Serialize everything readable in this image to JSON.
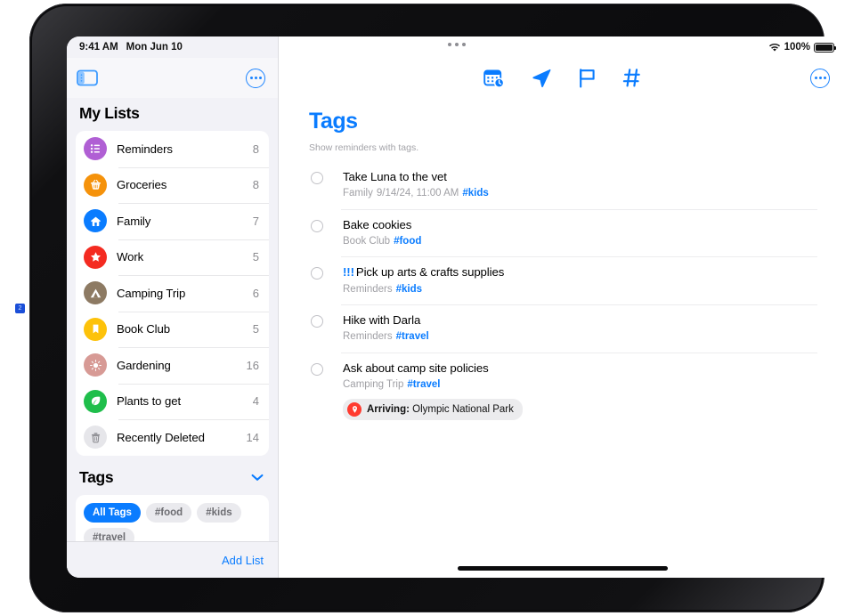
{
  "status_bar": {
    "time": "9:41 AM",
    "date": "Mon Jun 10",
    "wifi_icon": "wifi-icon",
    "battery_percent": "100%",
    "battery_icon": "battery-full-icon"
  },
  "window_controls": {
    "dots_icon": "window-drag-dots-icon"
  },
  "sidebar": {
    "toggle_icon": "sidebar-toggle-icon",
    "more_icon": "more-options-icon",
    "my_lists_title": "My Lists",
    "lists": [
      {
        "label": "Reminders",
        "count": "8",
        "icon": "list-bullet-icon",
        "color": "#b05fd4"
      },
      {
        "label": "Groceries",
        "count": "8",
        "icon": "basket-icon",
        "color": "#f5920b"
      },
      {
        "label": "Family",
        "count": "7",
        "icon": "house-icon",
        "color": "#0a7cff"
      },
      {
        "label": "Work",
        "count": "5",
        "icon": "star-icon",
        "color": "#f42b21"
      },
      {
        "label": "Camping Trip",
        "count": "6",
        "icon": "tent-icon",
        "color": "#8d7a63"
      },
      {
        "label": "Book Club",
        "count": "5",
        "icon": "bookmark-icon",
        "color": "#fdc20a"
      },
      {
        "label": "Gardening",
        "count": "16",
        "icon": "sun-icon",
        "color": "#d79a95"
      },
      {
        "label": "Plants to get",
        "count": "4",
        "icon": "leaf-icon",
        "color": "#1fbe4b"
      },
      {
        "label": "Recently Deleted",
        "count": "14",
        "icon": "trash-icon",
        "color": "#e8e8ea"
      }
    ],
    "tags_title": "Tags",
    "tags_chevron_icon": "chevron-down-icon",
    "tag_chips": [
      {
        "label": "All Tags",
        "selected": true
      },
      {
        "label": "#food",
        "selected": false
      },
      {
        "label": "#kids",
        "selected": false
      },
      {
        "label": "#travel",
        "selected": false
      }
    ],
    "add_list_label": "Add List"
  },
  "main": {
    "toolbar_icons": [
      {
        "name": "scheduled-calendar-icon"
      },
      {
        "name": "location-arrow-icon"
      },
      {
        "name": "flag-icon"
      },
      {
        "name": "hashtag-icon"
      }
    ],
    "more_icon": "more-options-icon",
    "title": "Tags",
    "subtitle": "Show reminders with tags.",
    "reminders": [
      {
        "priority": "",
        "title": "Take Luna to the vet",
        "list": "Family",
        "when": "9/14/24, 11:00 AM",
        "tag": "#kids",
        "location_badge": null
      },
      {
        "priority": "",
        "title": "Bake cookies",
        "list": "Book Club",
        "when": "",
        "tag": "#food",
        "location_badge": null
      },
      {
        "priority": "!!!",
        "title": "Pick up arts & crafts supplies",
        "list": "Reminders",
        "when": "",
        "tag": "#kids",
        "location_badge": null
      },
      {
        "priority": "",
        "title": "Hike with Darla",
        "list": "Reminders",
        "when": "",
        "tag": "#travel",
        "location_badge": null
      },
      {
        "priority": "",
        "title": "Ask about camp site policies",
        "list": "Camping Trip",
        "when": "",
        "tag": "#travel",
        "location_badge": {
          "prefix": "Arriving:",
          "value": "Olympic National Park",
          "icon": "location-pin-icon"
        }
      }
    ]
  },
  "annotation_marker": {
    "label": "2"
  },
  "colors": {
    "accent": "#0a7cff",
    "sidebar_bg": "#f2f2f7",
    "secondary_text": "#a0a0a5",
    "alert_red": "#ff3b30"
  }
}
